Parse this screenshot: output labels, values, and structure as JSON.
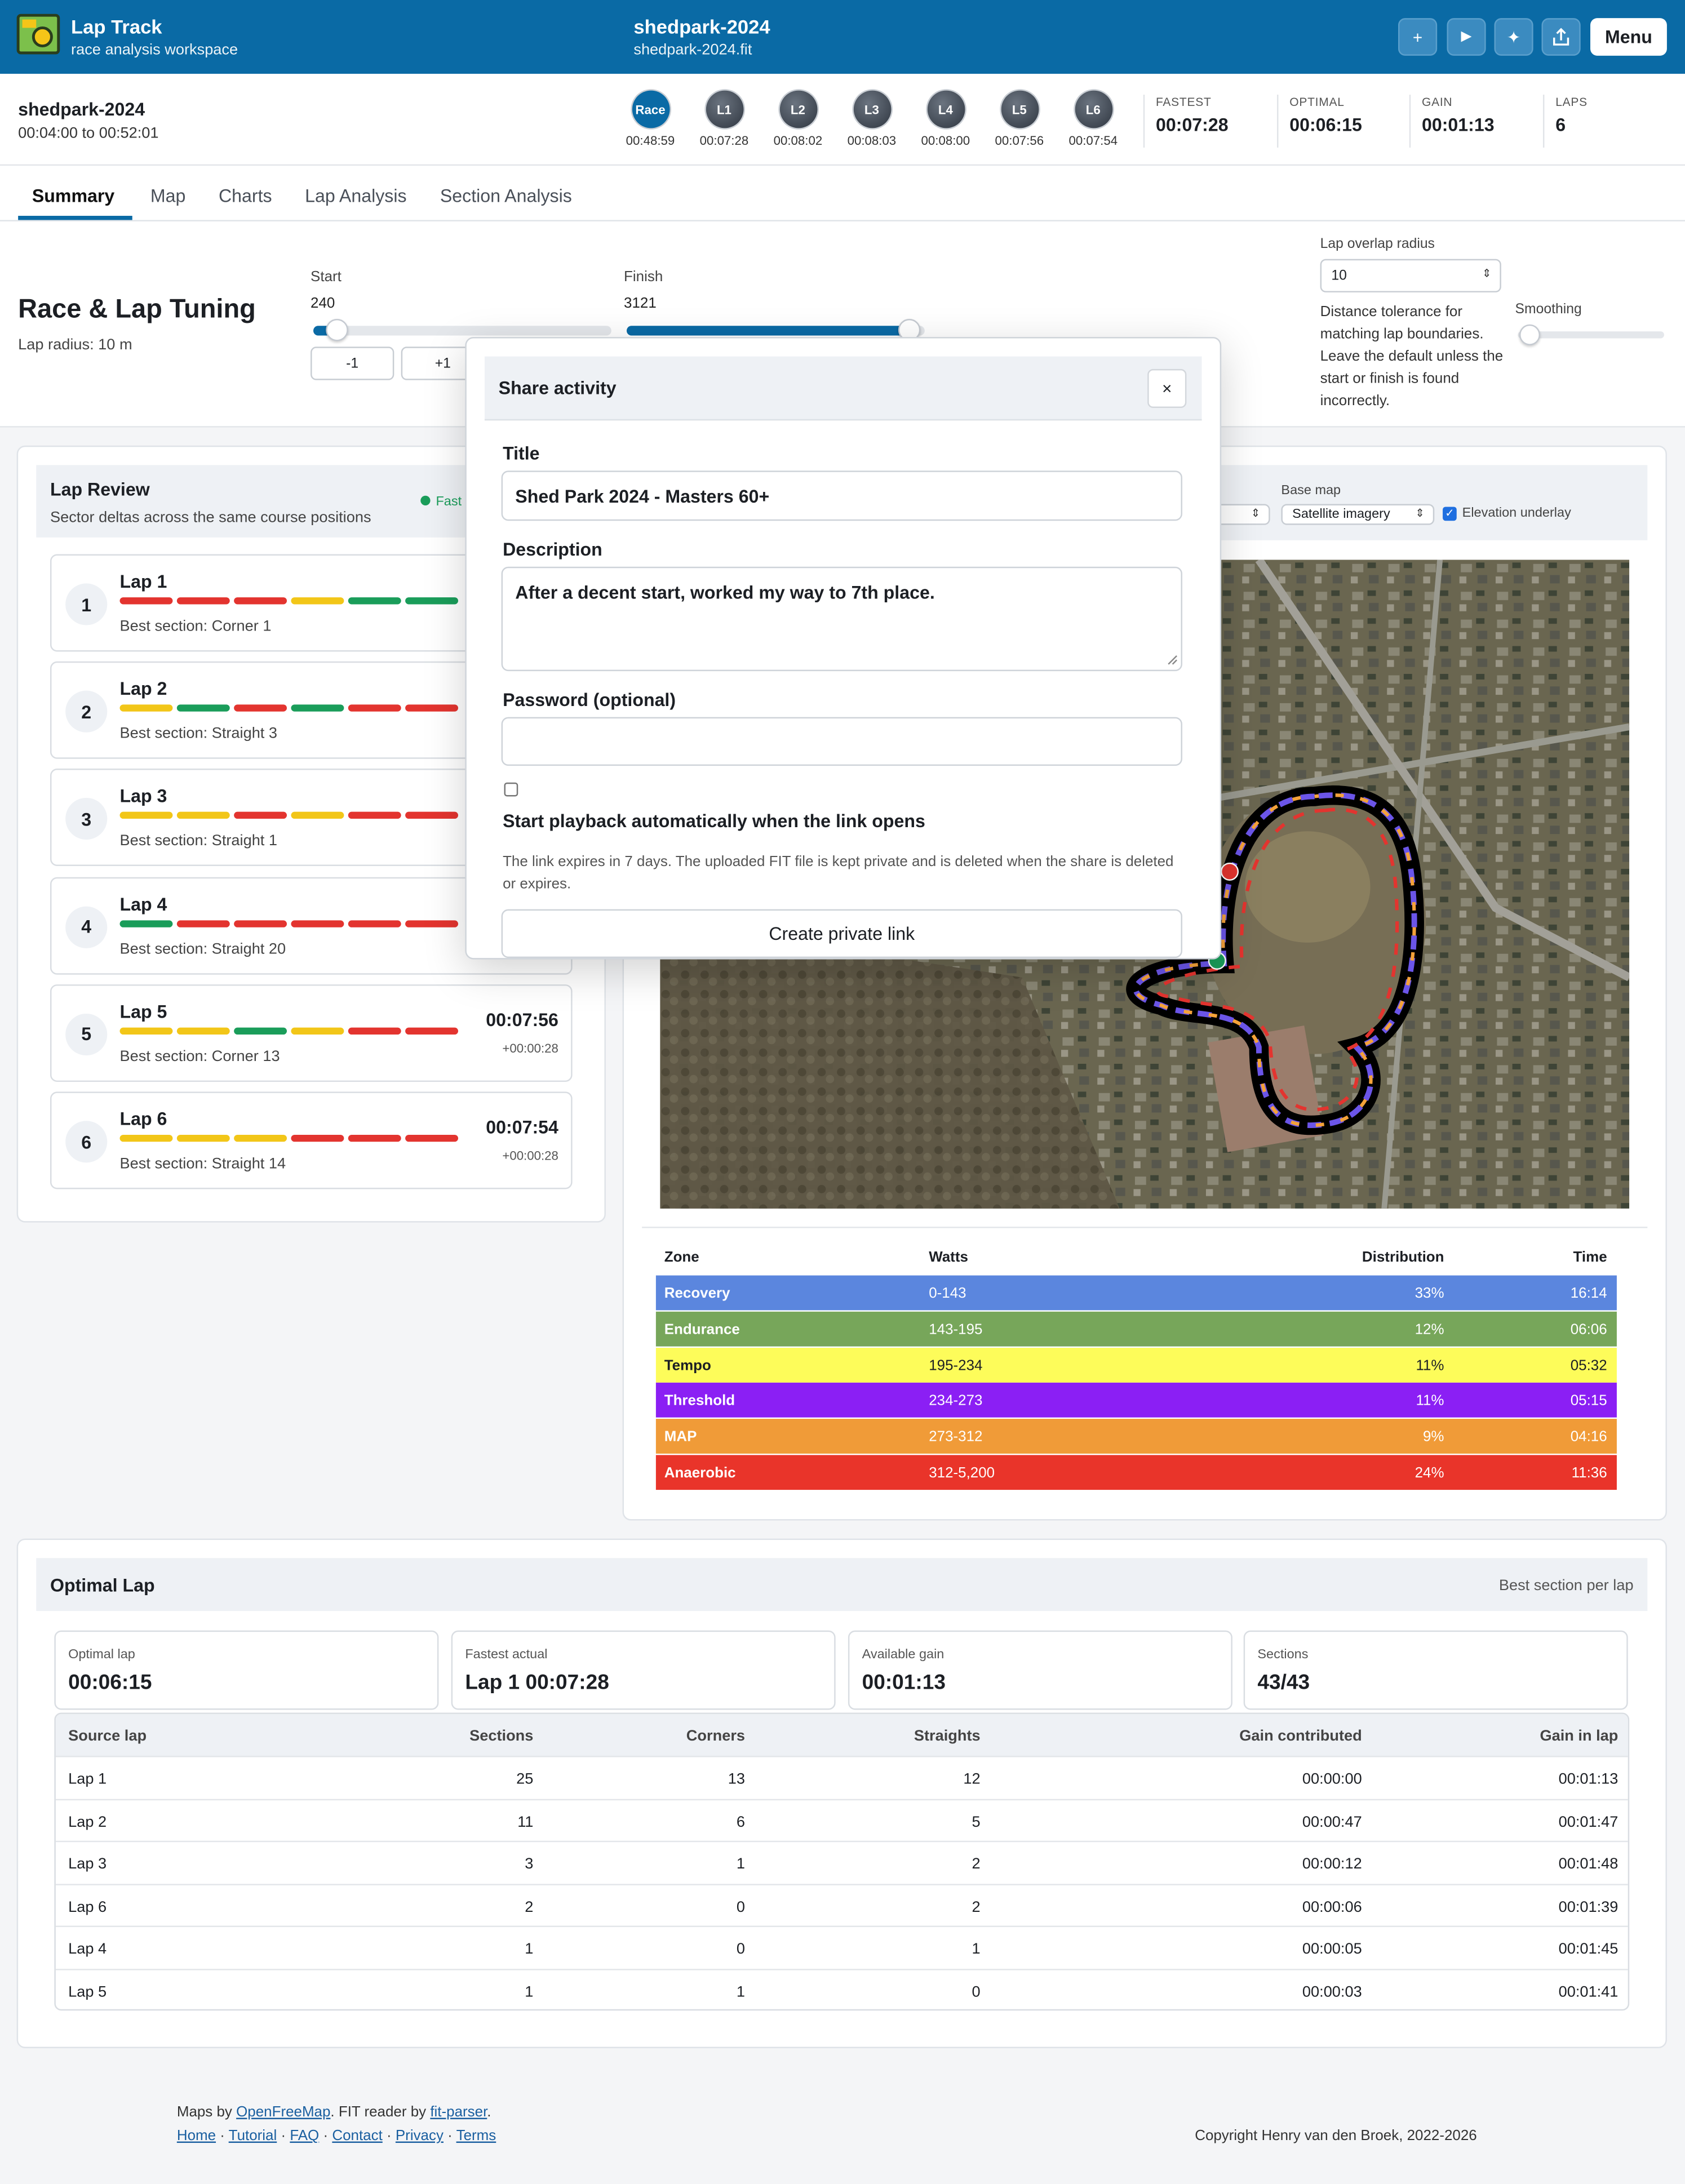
{
  "app": {
    "title": "Lap Track",
    "subtitle": "race analysis workspace"
  },
  "file": {
    "title": "shedpark-2024",
    "name": "shedpark-2024.fit"
  },
  "header_buttons": {
    "add": "+",
    "play": "▶",
    "spark": "✦",
    "share": "⇪",
    "menu": "Menu"
  },
  "activity": {
    "name": "shedpark-2024",
    "range": "00:04:00 to 00:52:01"
  },
  "lap_chips": [
    {
      "label": "Race",
      "time": "00:48:59"
    },
    {
      "label": "L1",
      "time": "00:07:28"
    },
    {
      "label": "L2",
      "time": "00:08:02"
    },
    {
      "label": "L3",
      "time": "00:08:03"
    },
    {
      "label": "L4",
      "time": "00:08:00"
    },
    {
      "label": "L5",
      "time": "00:07:56"
    },
    {
      "label": "L6",
      "time": "00:07:54"
    }
  ],
  "stats": [
    {
      "key": "FASTEST",
      "value": "00:07:28"
    },
    {
      "key": "OPTIMAL",
      "value": "00:06:15"
    },
    {
      "key": "GAIN",
      "value": "00:01:13"
    },
    {
      "key": "LAPS",
      "value": "6"
    }
  ],
  "tabs": [
    "Summary",
    "Map",
    "Charts",
    "Lap Analysis",
    "Section Analysis"
  ],
  "tuning": {
    "title": "Race & Lap Tuning",
    "subtitle": "Lap radius: 10 m",
    "start_label": "Start",
    "start_value": "240",
    "finish_label": "Finish",
    "finish_value": "3121",
    "minus": "-1",
    "plus": "+1",
    "radius_label": "Lap overlap radius",
    "radius_value": "10",
    "radius_help": "Distance tolerance for matching lap boundaries. Leave the default unless the start or finish is found incorrectly.",
    "smoothing_label": "Smoothing",
    "start_fraction": 0.08,
    "finish_fraction": 0.95
  },
  "lap_review": {
    "title": "Lap Review",
    "subtitle": "Sector deltas across the same course positions",
    "legend_fast": "Fast",
    "colors": {
      "g": "#1a9d5a",
      "r": "#e3342f",
      "y": "#f2c618"
    },
    "laps": [
      {
        "num": "1",
        "name": "Lap 1",
        "best": "Best section: Corner 1",
        "time": "",
        "delta": "",
        "segs": "rrrygg"
      },
      {
        "num": "2",
        "name": "Lap 2",
        "best": "Best section: Straight 3",
        "time": "",
        "delta": "",
        "segs": "ygrgrr"
      },
      {
        "num": "3",
        "name": "Lap 3",
        "best": "Best section: Straight 1",
        "time": "",
        "delta": "",
        "segs": "yyryrr"
      },
      {
        "num": "4",
        "name": "Lap 4",
        "best": "Best section: Straight 20",
        "time": "",
        "delta": "",
        "segs": "grrrrr"
      },
      {
        "num": "5",
        "name": "Lap 5",
        "best": "Best section: Corner 13",
        "time": "00:07:56",
        "delta": "+00:00:28",
        "segs": "yygyrr"
      },
      {
        "num": "6",
        "name": "Lap 6",
        "best": "Best section: Straight 14",
        "time": "00:07:54",
        "delta": "+00:00:28",
        "segs": "yyyrrr"
      }
    ]
  },
  "map_controls": {
    "color_label_tail": "r",
    "base_map_label": "Base map",
    "base_map_value": "Satellite imagery",
    "elevation_label": "Elevation underlay"
  },
  "zones": {
    "headers": {
      "zone": "Zone",
      "watts": "Watts",
      "distribution": "Distribution",
      "time": "Time"
    },
    "rows": [
      {
        "zone": "Recovery",
        "watts": "0-143",
        "distribution": "33%",
        "time": "16:14",
        "bg": "#5b86de",
        "fg": "#ffffff"
      },
      {
        "zone": "Endurance",
        "watts": "143-195",
        "distribution": "12%",
        "time": "06:06",
        "bg": "#77a65a",
        "fg": "#ffffff"
      },
      {
        "zone": "Tempo",
        "watts": "195-234",
        "distribution": "11%",
        "time": "05:32",
        "bg": "#fdfc5a",
        "fg": "#1c1f24"
      },
      {
        "zone": "Threshold",
        "watts": "234-273",
        "distribution": "11%",
        "time": "05:15",
        "bg": "#8b1ff4",
        "fg": "#ffffff"
      },
      {
        "zone": "MAP",
        "watts": "273-312",
        "distribution": "9%",
        "time": "04:16",
        "bg": "#f09b38",
        "fg": "#ffffff"
      },
      {
        "zone": "Anaerobic",
        "watts": "312-5,200",
        "distribution": "24%",
        "time": "11:36",
        "bg": "#e9342a",
        "fg": "#ffffff"
      }
    ]
  },
  "optimal": {
    "title": "Optimal Lap",
    "right_note": "Best section per lap",
    "cards": [
      {
        "key": "Optimal lap",
        "value": "00:06:15"
      },
      {
        "key": "Fastest actual",
        "value": "Lap 1 00:07:28"
      },
      {
        "key": "Available gain",
        "value": "00:01:13"
      },
      {
        "key": "Sections",
        "value": "43/43"
      }
    ],
    "headers": {
      "source": "Source lap",
      "sections": "Sections",
      "corners": "Corners",
      "straights": "Straights",
      "gain": "Gain contributed",
      "gain_lap": "Gain in lap"
    },
    "rows": [
      {
        "source": "Lap 1",
        "sections": "25",
        "corners": "13",
        "straights": "12",
        "gain": "00:00:00",
        "gain_lap": "00:01:13"
      },
      {
        "source": "Lap 2",
        "sections": "11",
        "corners": "6",
        "straights": "5",
        "gain": "00:00:47",
        "gain_lap": "00:01:47"
      },
      {
        "source": "Lap 3",
        "sections": "3",
        "corners": "1",
        "straights": "2",
        "gain": "00:00:12",
        "gain_lap": "00:01:48"
      },
      {
        "source": "Lap 6",
        "sections": "2",
        "corners": "0",
        "straights": "2",
        "gain": "00:00:06",
        "gain_lap": "00:01:39"
      },
      {
        "source": "Lap 4",
        "sections": "1",
        "corners": "0",
        "straights": "1",
        "gain": "00:00:05",
        "gain_lap": "00:01:45"
      },
      {
        "source": "Lap 5",
        "sections": "1",
        "corners": "1",
        "straights": "0",
        "gain": "00:00:03",
        "gain_lap": "00:01:41"
      }
    ]
  },
  "share": {
    "title": "Share activity",
    "close": "×",
    "title_label": "Title",
    "title_value": "Shed Park 2024 - Masters 60+",
    "desc_label": "Description",
    "desc_value": "After a decent start, worked my way to 7th place.",
    "password_label": "Password (optional)",
    "password_value": "",
    "autoplay_label": "Start playback automatically when the link opens",
    "note": "The link expires in 7 days. The uploaded FIT file is kept private and is deleted when the share is deleted or expires.",
    "create": "Create private link"
  },
  "footer": {
    "maps_by": "Maps by ",
    "openfreemap": "OpenFreeMap",
    "fit_by": ". FIT reader by ",
    "fitparser": "fit-parser",
    "end": ".",
    "links": [
      "Home",
      "Tutorial",
      "FAQ",
      "Contact",
      "Privacy",
      "Terms"
    ],
    "sep": " · ",
    "copyright": "Copyright Henry van den Broek, 2022-2026"
  }
}
